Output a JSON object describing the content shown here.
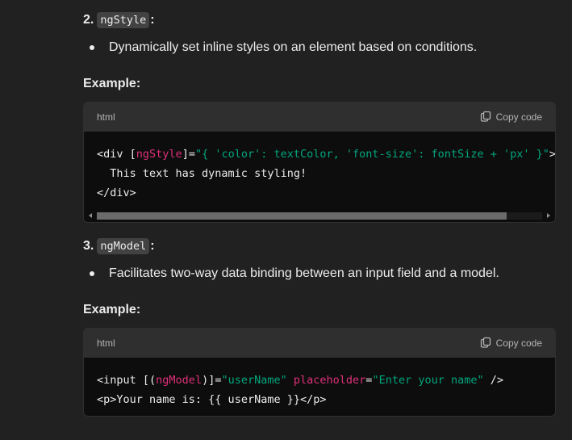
{
  "sections": [
    {
      "number": "2.",
      "code_term": "ngStyle",
      "colon": ":",
      "bullet": "Dynamically set inline styles on an element based on conditions.",
      "example_label": "Example:",
      "code": {
        "language": "html",
        "copy_label": "Copy code",
        "lines": [
          [
            {
              "t": "tag",
              "v": "<div "
            },
            {
              "t": "punc",
              "v": "["
            },
            {
              "t": "attr",
              "v": "ngStyle"
            },
            {
              "t": "punc",
              "v": "]="
            },
            {
              "t": "str",
              "v": "\"{ 'color': textColor, 'font-size': fontSize + 'px' }\""
            },
            {
              "t": "tag",
              "v": ">"
            }
          ],
          [
            {
              "t": "punc",
              "v": "  This text has dynamic styling!"
            }
          ],
          [
            {
              "t": "tag",
              "v": "</div>"
            }
          ]
        ],
        "has_scrollbar": true,
        "scroll_fraction": 0.92
      }
    },
    {
      "number": "3.",
      "code_term": "ngModel",
      "colon": ":",
      "bullet": "Facilitates two-way data binding between an input field and a model.",
      "example_label": "Example:",
      "code": {
        "language": "html",
        "copy_label": "Copy code",
        "lines": [
          [
            {
              "t": "tag",
              "v": "<input "
            },
            {
              "t": "punc",
              "v": "[("
            },
            {
              "t": "attr",
              "v": "ngModel"
            },
            {
              "t": "punc",
              "v": ")]="
            },
            {
              "t": "str",
              "v": "\"userName\""
            },
            {
              "t": "punc",
              "v": " "
            },
            {
              "t": "attr",
              "v": "placeholder"
            },
            {
              "t": "punc",
              "v": "="
            },
            {
              "t": "str",
              "v": "\"Enter your name\""
            },
            {
              "t": "tag",
              "v": " />"
            }
          ],
          [
            {
              "t": "tag",
              "v": "<p>"
            },
            {
              "t": "punc",
              "v": "Your name is: {{ userName }}"
            },
            {
              "t": "tag",
              "v": "</p>"
            }
          ]
        ],
        "has_scrollbar": false
      }
    }
  ],
  "colors": {
    "background": "#212121",
    "code_header": "#2f2f2f",
    "code_body": "#0d0d0d",
    "attribute": "#df3079",
    "string": "#00a67d"
  },
  "icons": {
    "copy": "copy-icon"
  }
}
